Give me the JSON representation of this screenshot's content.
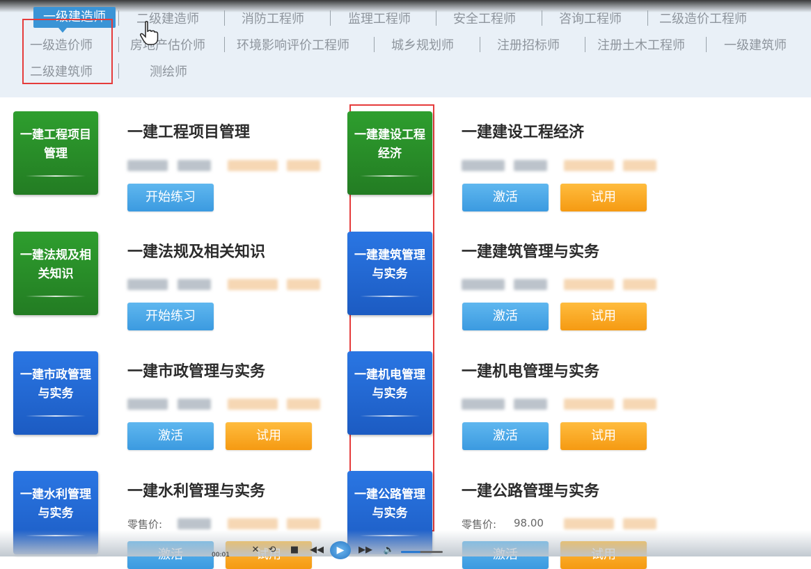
{
  "nav": {
    "items": [
      {
        "label": "一级建造师",
        "active": true
      },
      {
        "label": "二级建造师"
      },
      {
        "label": "消防工程师"
      },
      {
        "label": "监理工程师"
      },
      {
        "label": "安全工程师"
      },
      {
        "label": "咨询工程师"
      },
      {
        "label": "二级造价工程师"
      },
      {
        "label": "一级造价师"
      },
      {
        "label": "房地产估价师"
      },
      {
        "label": "环境影响评价工程师"
      },
      {
        "label": "城乡规划师"
      },
      {
        "label": "注册招标师"
      },
      {
        "label": "注册土木工程师"
      },
      {
        "label": "一级建筑师"
      },
      {
        "label": "二级建筑师"
      },
      {
        "label": "测绘师"
      }
    ]
  },
  "courses": [
    {
      "tile": "一建工程项目管理",
      "tile_color": "#2e9e2e",
      "title": "一建工程项目管理",
      "buttons": [
        "开始练习"
      ]
    },
    {
      "tile": "一建建设工程经济",
      "tile_color": "#2e9e2e",
      "title": "一建建设工程经济",
      "buttons": [
        "激活",
        "试用"
      ]
    },
    {
      "tile": "一建法规及相关知识",
      "tile_color": "#2e9e2e",
      "title": "一建法规及相关知识",
      "buttons": [
        "开始练习"
      ]
    },
    {
      "tile": "一建建筑管理与实务",
      "tile_color": "#2a76e3",
      "title": "一建建筑管理与实务",
      "buttons": [
        "激活",
        "试用"
      ]
    },
    {
      "tile": "一建市政管理与实务",
      "tile_color": "#2a76e3",
      "title": "一建市政管理与实务",
      "buttons": [
        "激活",
        "试用"
      ]
    },
    {
      "tile": "一建机电管理与实务",
      "tile_color": "#2a76e3",
      "title": "一建机电管理与实务",
      "buttons": [
        "激活",
        "试用"
      ]
    },
    {
      "tile": "一建水利管理与实务",
      "tile_color": "#2a76e3",
      "title": "一建水利管理与实务",
      "price_label": "零售价:",
      "buttons": [
        "激活",
        "试用"
      ]
    },
    {
      "tile": "一建公路管理与实务",
      "tile_color": "#2a76e3",
      "title": "一建公路管理与实务",
      "price_label": "零售价:",
      "price_value": "98.00",
      "buttons": [
        "激活",
        "试用"
      ]
    }
  ],
  "player": {
    "time": "00:01",
    "icons": [
      "close-icon",
      "restore-icon",
      "stop-icon",
      "previous-icon",
      "play-icon",
      "next-icon",
      "volume-icon"
    ]
  },
  "colors": {
    "accent": "#3a94d6",
    "green_tile": "#2e9e2e",
    "blue_tile": "#2a76e3",
    "highlight": "#e53b3b",
    "btn_blue": "#4aa6e6",
    "btn_orange": "#f7a623"
  }
}
